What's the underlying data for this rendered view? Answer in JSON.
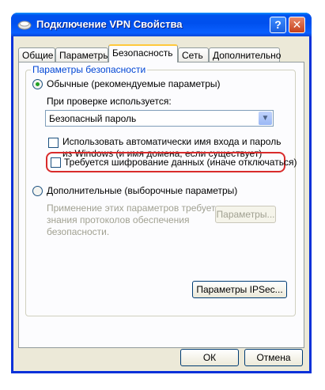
{
  "window": {
    "title": "Подключение VPN Свойства",
    "help_button": "?",
    "close_button": "✕"
  },
  "tabs": [
    {
      "label": "Общие"
    },
    {
      "label": "Параметры"
    },
    {
      "label": "Безопасность"
    },
    {
      "label": "Сеть"
    },
    {
      "label": "Дополнительно"
    }
  ],
  "security": {
    "group_title": "Параметры безопасности",
    "typical_radio": "Обычные (рекомендуемые параметры)",
    "verify_label": "При проверке используется:",
    "verify_selected": "Безопасный пароль",
    "auto_logon_line1": "Использовать автоматически имя входа и пароль",
    "auto_logon_line2": "из Windows (и имя домена, если существует)",
    "encryption_label": "Требуется шифрование данных (иначе отключаться)",
    "advanced_radio": "Дополнительные (выборочные параметры)",
    "advanced_desc_line1": "Применение этих параметров требует",
    "advanced_desc_line2": "знания протоколов обеспечения",
    "advanced_desc_line3": "безопасности.",
    "params_button": "Параметры...",
    "ipsec_button": "Параметры IPSec..."
  },
  "footer": {
    "ok_button": "ОК",
    "cancel_button": "Отмена"
  }
}
